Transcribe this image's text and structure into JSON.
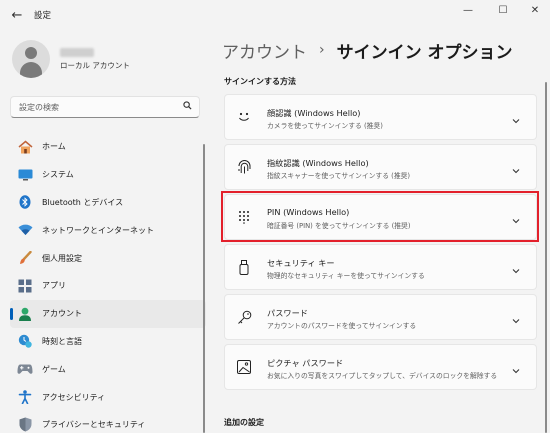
{
  "window": {
    "title": "設定",
    "controls": {
      "minimize": "—",
      "maximize": "☐",
      "close": "✕"
    },
    "back_glyph": "←"
  },
  "profile": {
    "account_type": "ローカル アカウント"
  },
  "search": {
    "placeholder": "設定の検索",
    "icon": "search-icon"
  },
  "nav": {
    "items": [
      {
        "label": "ホーム",
        "icon": "home-icon"
      },
      {
        "label": "システム",
        "icon": "system-icon"
      },
      {
        "label": "Bluetooth とデバイス",
        "icon": "bluetooth-icon"
      },
      {
        "label": "ネットワークとインターネット",
        "icon": "wifi-icon"
      },
      {
        "label": "個人用設定",
        "icon": "brush-icon"
      },
      {
        "label": "アプリ",
        "icon": "apps-icon"
      },
      {
        "label": "アカウント",
        "icon": "account-icon",
        "active": true
      },
      {
        "label": "時刻と言語",
        "icon": "time-language-icon"
      },
      {
        "label": "ゲーム",
        "icon": "game-icon"
      },
      {
        "label": "アクセシビリティ",
        "icon": "accessibility-icon"
      },
      {
        "label": "プライバシーとセキュリティ",
        "icon": "shield-icon"
      }
    ]
  },
  "breadcrumb": {
    "parent": "アカウント",
    "separator": "›",
    "current": "サインイン オプション"
  },
  "sections": {
    "signin_methods": "サインインする方法",
    "additional": "追加の設定"
  },
  "methods": [
    {
      "title": "顔認識 (Windows Hello)",
      "desc": "カメラを使ってサインインする (推奨)",
      "icon": "face-icon"
    },
    {
      "title": "指紋認識 (Windows Hello)",
      "desc": "指紋スキャナーを使ってサインインする (推奨)",
      "icon": "fingerprint-icon"
    },
    {
      "title": "PIN (Windows Hello)",
      "desc": "暗証番号 (PIN) を使ってサインインする (推奨)",
      "icon": "pin-keypad-icon"
    },
    {
      "title": "セキュリティ キー",
      "desc": "物理的なセキュリティ キーを使ってサインインする",
      "icon": "usb-key-icon"
    },
    {
      "title": "パスワード",
      "desc": "アカウントのパスワードを使ってサインインする",
      "icon": "key-icon"
    },
    {
      "title": "ピクチャ パスワード",
      "desc": "お気に入りの写真をスワイプしてタップして、デバイスのロックを解除する",
      "icon": "picture-icon"
    }
  ],
  "colors": {
    "accent": "#005fb8",
    "highlight": "#e3202b"
  }
}
